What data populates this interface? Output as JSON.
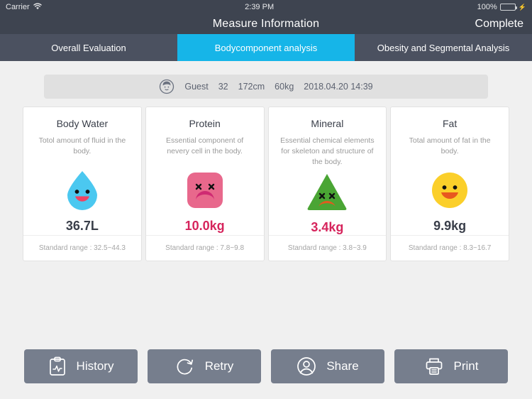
{
  "statusbar": {
    "carrier": "Carrier",
    "wifi_icon": "wifi-icon",
    "time": "2:39 PM",
    "battery_percent": "100%",
    "battery_icon": "battery-icon",
    "charging_icon": "lightning-bolt-icon"
  },
  "navbar": {
    "title": "Measure Information",
    "right_action": "Complete"
  },
  "tabs": [
    {
      "label": "Overall Evaluation",
      "active": false
    },
    {
      "label": "Bodycomponent analysis",
      "active": true
    },
    {
      "label": "Obesity and Segmental Analysis",
      "active": false
    }
  ],
  "infobar": {
    "avatar_icon": "user-avatar-icon",
    "name": "Guest",
    "age": "32",
    "height": "172cm",
    "weight": "60kg",
    "datetime": "2018.04.20 14:39"
  },
  "cards": [
    {
      "title": "Body Water",
      "description": "Totol amount of fluid in the body.",
      "icon": "water-drop-happy-icon",
      "value": "36.7L",
      "alert": false,
      "range": "Standard range : 32.5~44.3",
      "icon_color": "#4bc8f0",
      "mouth_color": "#ef4464"
    },
    {
      "title": "Protein",
      "description": "Essential component of nevery cell in the body.",
      "icon": "protein-square-sad-icon",
      "value": "10.0kg",
      "alert": true,
      "range": "Standard range : 7.8~9.8",
      "icon_color": "#e8688c",
      "mouth_color": "#cf2a72"
    },
    {
      "title": "Mineral",
      "description": "Essential chemical elements for skeleton and structure of the body.",
      "icon": "mineral-triangle-sad-icon",
      "value": "3.4kg",
      "alert": true,
      "range": "Standard range : 3.8~3.9",
      "icon_color": "#4aa534",
      "mouth_color": "#e05c1f"
    },
    {
      "title": "Fat",
      "description": "Total amount of fat in the body.",
      "icon": "fat-circle-happy-icon",
      "value": "9.9kg",
      "alert": false,
      "range": "Standard range : 8.3~16.7",
      "icon_color": "#fbcf2a",
      "mouth_color": "#e8571f"
    }
  ],
  "buttons": [
    {
      "label": "History",
      "icon": "clipboard-chart-icon"
    },
    {
      "label": "Retry",
      "icon": "refresh-circle-arrow-icon"
    },
    {
      "label": "Share",
      "icon": "person-circle-icon"
    },
    {
      "label": "Print",
      "icon": "printer-icon"
    }
  ],
  "colors": {
    "accent": "#16b5e8",
    "navbar": "#3e4450",
    "tabbar": "#4b5160",
    "background": "#f0f0f0",
    "alert_value": "#d6245c",
    "button": "#767e8d"
  }
}
